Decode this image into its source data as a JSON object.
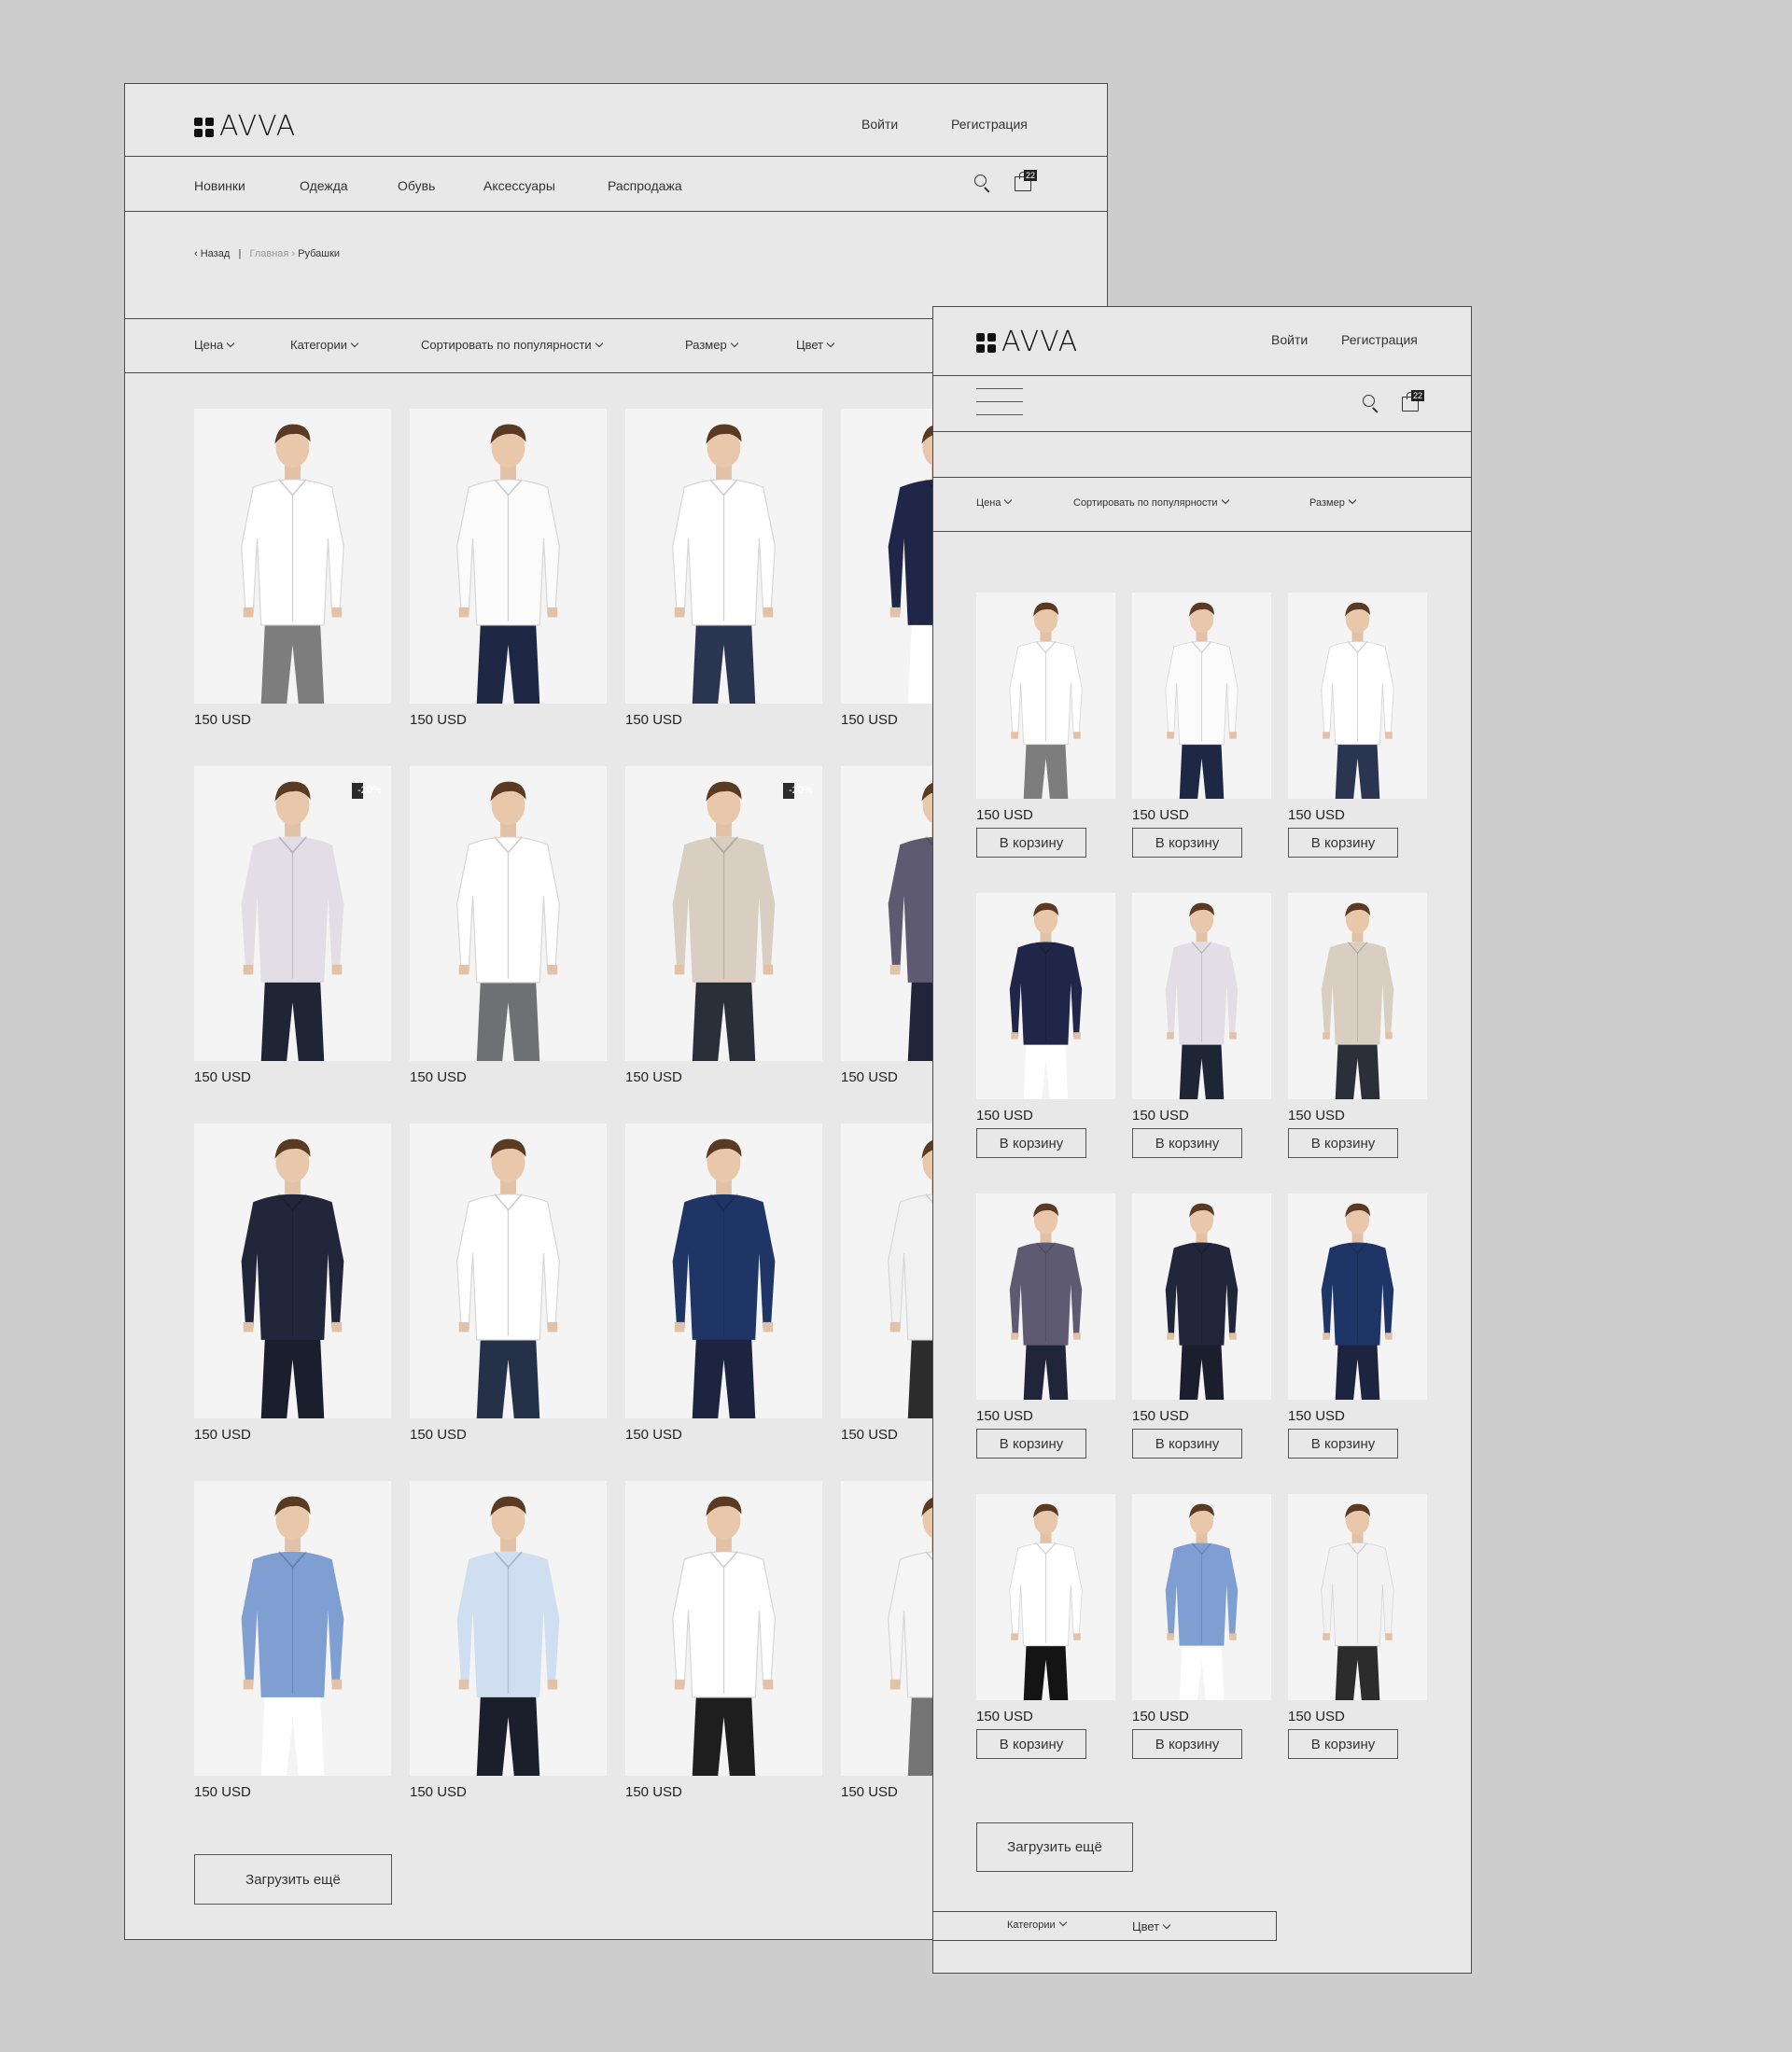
{
  "brand": {
    "logo_text": "AVVA"
  },
  "desktop": {
    "auth": {
      "login": "Войти",
      "register": "Регистрация"
    },
    "nav": [
      "Новинки",
      "Одежда",
      "Обувь",
      "Аксессуары",
      "Распродажа"
    ],
    "cart_count": "22",
    "breadcrumb": {
      "back": "Назад",
      "home": "Главная",
      "current": "Рубашки"
    },
    "filters": [
      "Цена",
      "Категории",
      "Сортировать по популярности",
      "Размер",
      "Цвет"
    ],
    "products": [
      {
        "price": "150 USD",
        "shirt": "#ffffff",
        "pants": "#7d7d7d"
      },
      {
        "price": "150 USD",
        "shirt": "#fbfbfb",
        "pants": "#1e2744"
      },
      {
        "price": "150 USD",
        "shirt": "#ffffff",
        "pants": "#2a3552"
      },
      {
        "price": "150 USD",
        "shirt": "#1f2647",
        "pants": "#ffffff"
      },
      {
        "price": "150 USD",
        "shirt": "#e3dde6",
        "pants": "#1e2535",
        "badge": "-20%"
      },
      {
        "price": "150 USD",
        "shirt": "#ffffff",
        "pants": "#6f7074"
      },
      {
        "price": "150 USD",
        "shirt": "#d9cec2",
        "pants": "#2a2f3a",
        "badge": "-20%"
      },
      {
        "price": "150 USD",
        "shirt": "#5e5a72",
        "pants": "#20253a"
      },
      {
        "price": "150 USD",
        "shirt": "#22263a",
        "pants": "#1b1e2d"
      },
      {
        "price": "150 USD",
        "shirt": "#ffffff",
        "pants": "#253049"
      },
      {
        "price": "150 USD",
        "shirt": "#1f3566",
        "pants": "#1c2440"
      },
      {
        "price": "150 USD",
        "shirt": "#f1f1f1",
        "pants": "#2c2c2c"
      },
      {
        "price": "150 USD",
        "shirt": "#7f9fd2",
        "pants": "#ffffff"
      },
      {
        "price": "150 USD",
        "shirt": "#cfdff1",
        "pants": "#1b1f2c"
      },
      {
        "price": "150 USD",
        "shirt": "#ffffff",
        "pants": "#1e1e1e"
      },
      {
        "price": "150 USD",
        "shirt": "#f5f5f5",
        "pants": "#747474"
      }
    ],
    "load_more": "Загрузить ещё"
  },
  "mobile": {
    "auth": {
      "login": "Войти",
      "register": "Регистрация"
    },
    "cart_count": "22",
    "filters": [
      "Цена",
      "Сортировать по популярности",
      "Размер"
    ],
    "products": [
      {
        "price": "150 USD",
        "shirt": "#ffffff",
        "pants": "#7d7d7d"
      },
      {
        "price": "150 USD",
        "shirt": "#fbfbfb",
        "pants": "#1e2744"
      },
      {
        "price": "150 USD",
        "shirt": "#ffffff",
        "pants": "#2a3552"
      },
      {
        "price": "150 USD",
        "shirt": "#1f2647",
        "pants": "#ffffff"
      },
      {
        "price": "150 USD",
        "shirt": "#e3dde6",
        "pants": "#1e2535"
      },
      {
        "price": "150 USD",
        "shirt": "#d9cec2",
        "pants": "#2a2f3a"
      },
      {
        "price": "150 USD",
        "shirt": "#5e5a72",
        "pants": "#20253a"
      },
      {
        "price": "150 USD",
        "shirt": "#22263a",
        "pants": "#1b1e2d"
      },
      {
        "price": "150 USD",
        "shirt": "#1f3566",
        "pants": "#1c2440"
      },
      {
        "price": "150 USD",
        "shirt": "#ffffff",
        "pants": "#141414"
      },
      {
        "price": "150 USD",
        "shirt": "#7f9fd2",
        "pants": "#ffffff"
      },
      {
        "price": "150 USD",
        "shirt": "#f2f2f2",
        "pants": "#2c2c2c"
      }
    ],
    "add_to_cart": "В корзину",
    "load_more": "Загрузить ещё",
    "bottom_filters": [
      "Категории",
      "Цвет"
    ]
  }
}
